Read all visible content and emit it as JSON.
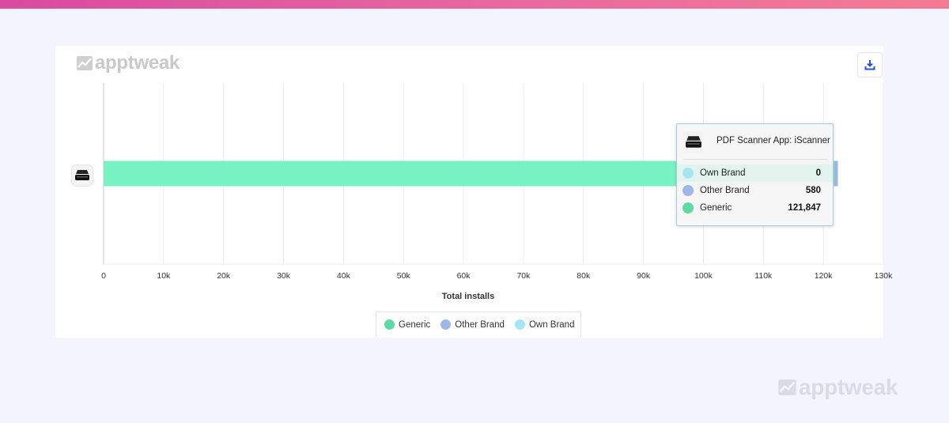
{
  "branding": {
    "logo_text": "apptweak"
  },
  "toolbar": {
    "download_icon": "download-icon"
  },
  "colors": {
    "generic": "#78f2c2",
    "other_brand": "#9fb6e8",
    "own_brand": "#a6e6f2"
  },
  "chart_data": {
    "type": "bar",
    "orientation": "horizontal",
    "stacked": true,
    "categories": [
      "PDF Scanner App: iScanner"
    ],
    "series": [
      {
        "name": "Generic",
        "values": [
          121847
        ],
        "color": "#78f2c2"
      },
      {
        "name": "Other Brand",
        "values": [
          580
        ],
        "color": "#9fb6e8"
      },
      {
        "name": "Own Brand",
        "values": [
          0
        ],
        "color": "#a6e6f2"
      }
    ],
    "xlabel": "Total installs",
    "xlim": [
      0,
      130000
    ],
    "xticks": [
      0,
      10000,
      20000,
      30000,
      40000,
      50000,
      60000,
      70000,
      80000,
      90000,
      100000,
      110000,
      120000,
      130000
    ],
    "xtick_labels": [
      "0",
      "10k",
      "20k",
      "30k",
      "40k",
      "50k",
      "60k",
      "70k",
      "80k",
      "90k",
      "100k",
      "110k",
      "120k",
      "130k"
    ],
    "grid": true,
    "legend_position": "bottom-center",
    "legend": [
      "Generic",
      "Other Brand",
      "Own Brand"
    ]
  },
  "tooltip": {
    "title": "PDF Scanner App: iScanner",
    "rows": [
      {
        "label": "Own Brand",
        "value": "0",
        "color": "#a6e6f2",
        "highlighted": true
      },
      {
        "label": "Other Brand",
        "value": "580",
        "color": "#9fb6e8",
        "highlighted": false
      },
      {
        "label": "Generic",
        "value": "121,847",
        "color": "#5fd9a6",
        "highlighted": false
      }
    ]
  }
}
